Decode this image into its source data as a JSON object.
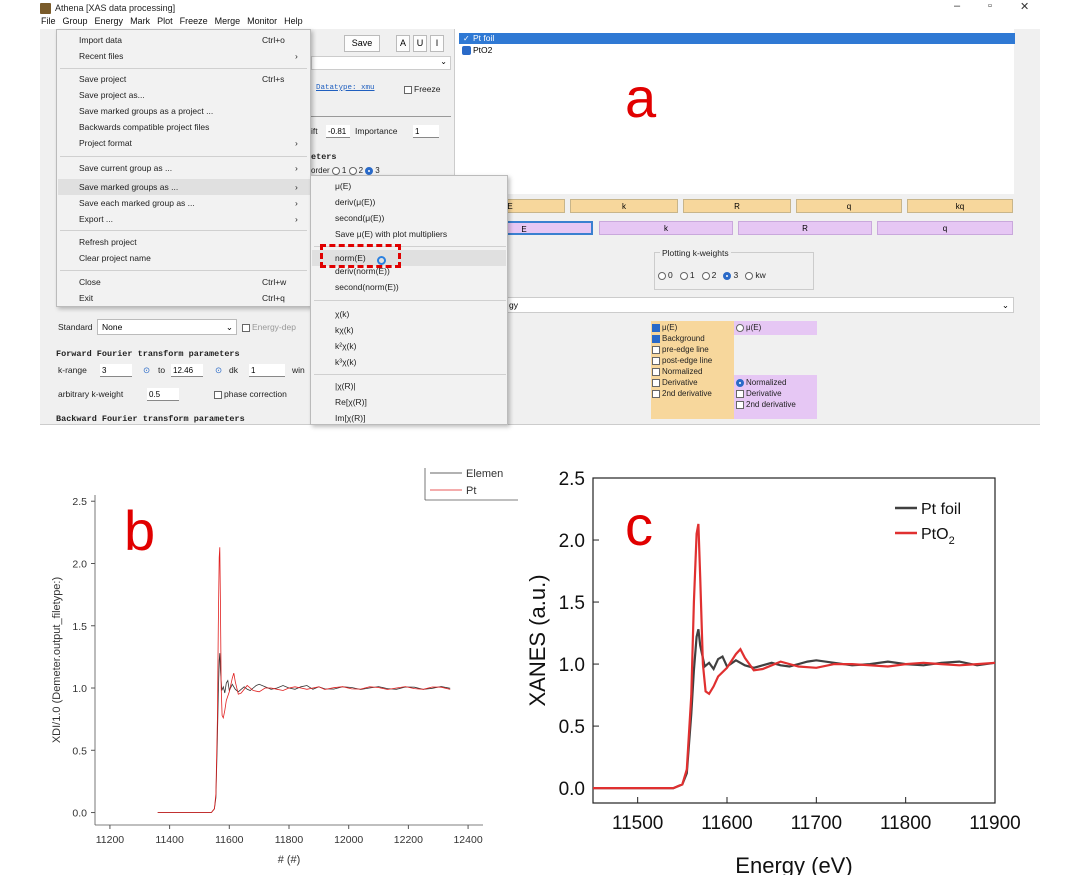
{
  "app": {
    "title": "Athena [XAS data processing]",
    "window_controls": [
      "–",
      "▫",
      "✕"
    ],
    "menus": [
      "File",
      "Group",
      "Energy",
      "Mark",
      "Plot",
      "Freeze",
      "Merge",
      "Monitor",
      "Help"
    ]
  },
  "file_menu": {
    "items": [
      {
        "label": "Import data",
        "shortcut": "Ctrl+o",
        "arrow": ""
      },
      {
        "label": "Recent files",
        "shortcut": "",
        "arrow": "›"
      },
      {
        "label": "Save project",
        "shortcut": "Ctrl+s",
        "arrow": ""
      },
      {
        "label": "Save project as...",
        "shortcut": "",
        "arrow": ""
      },
      {
        "label": "Save marked groups as a project ...",
        "shortcut": "",
        "arrow": ""
      },
      {
        "label": "Backwards compatible project files",
        "shortcut": "",
        "arrow": ""
      },
      {
        "label": "Project format",
        "shortcut": "",
        "arrow": "›"
      },
      {
        "label": "Save current group as ...",
        "shortcut": "",
        "arrow": "›"
      },
      {
        "label": "Save marked groups as ...",
        "shortcut": "",
        "arrow": "›"
      },
      {
        "label": "Save each marked group as ...",
        "shortcut": "",
        "arrow": "›"
      },
      {
        "label": "Export ...",
        "shortcut": "",
        "arrow": "›"
      },
      {
        "label": "Refresh project",
        "shortcut": "",
        "arrow": ""
      },
      {
        "label": "Clear project name",
        "shortcut": "",
        "arrow": ""
      },
      {
        "label": "Close",
        "shortcut": "Ctrl+w",
        "arrow": ""
      },
      {
        "label": "Exit",
        "shortcut": "Ctrl+q",
        "arrow": ""
      }
    ]
  },
  "submenu": {
    "items": [
      "μ(E)",
      "deriv(μ(E))",
      "second(μ(E))",
      "Save μ(E) with plot multipliers",
      "norm(E)",
      "deriv(norm(E))",
      "second(norm(E))",
      "χ(k)",
      "kχ(k)",
      "k²χ(k)",
      "k³χ(k)",
      "|χ(R)|",
      "Re[χ(R)]",
      "Im[χ(R)]"
    ]
  },
  "groups": {
    "items": [
      "Pt foil",
      "PtO2"
    ]
  },
  "toolbar": {
    "save": "Save",
    "a": "A",
    "u": "U",
    "i": "I"
  },
  "main_panel": {
    "datatype": "Datatype: xmu",
    "freeze": "Freeze",
    "shift_label": "ift",
    "shift_value": "-0.81",
    "importance_label": "Importance",
    "importance_value": "1",
    "section_params": "eters",
    "order_label": "order",
    "orders": [
      "1",
      "2",
      "3"
    ],
    "standard_label": "Standard",
    "standard_value": "None",
    "energy_dep": "Energy-dep",
    "fft_header": "Forward Fourier transform parameters",
    "krange_label": "k-range",
    "kmin": "3",
    "to": "to",
    "kmax": "12.46",
    "dk_label": "dk",
    "dk_value": "1",
    "win_label": "win",
    "arb_label": "arbitrary k-weight",
    "arb_value": "0.5",
    "phase_corr": "phase correction",
    "bft_header": "Backward Fourier transform parameters",
    "energy_fragment": "gy"
  },
  "plot_buttons": {
    "row1": [
      "E",
      "k",
      "R",
      "q",
      "kq"
    ],
    "row2": [
      "E",
      "k",
      "R",
      "q"
    ]
  },
  "kweights": {
    "title": "Plotting k-weights",
    "options": [
      "0",
      "1",
      "2",
      "3",
      "kw"
    ],
    "selected": "3"
  },
  "plot_options": {
    "left": [
      "μ(E)",
      "Background",
      "pre-edge line",
      "post-edge line",
      "Normalized",
      "Derivative",
      "2nd derivative"
    ],
    "left_checked": [
      true,
      true,
      false,
      false,
      false,
      false,
      false
    ],
    "right": [
      "μ(E)",
      "Normalized",
      "Derivative",
      "2nd derivative"
    ]
  },
  "labels": {
    "a": "a",
    "b": "b",
    "c": "c"
  },
  "chart_b": {
    "type": "line",
    "ylabel": "XDI/1.0 (Demeter.output_filetype:)",
    "xlabel": "# (#)",
    "legend": [
      "Elemen",
      "Pt"
    ],
    "xticks": [
      11200,
      11400,
      11600,
      11800,
      12000,
      12200,
      12400
    ],
    "yticks": [
      "0.0",
      "0.5",
      "1.0",
      "1.5",
      "2.0",
      "2.5"
    ],
    "xlim": [
      11150,
      12450
    ],
    "ylim": [
      -0.1,
      2.55
    ],
    "series_colors": [
      "#333333",
      "#e02020"
    ]
  },
  "chart_data": {
    "type": "line",
    "xlabel": "Energy (eV)",
    "ylabel": "XANES (a.u.)",
    "xlim": [
      11450,
      11900
    ],
    "ylim": [
      -0.12,
      2.5
    ],
    "xticks": [
      11500,
      11600,
      11700,
      11800,
      11900
    ],
    "yticks": [
      0.0,
      0.5,
      1.0,
      1.5,
      2.0,
      2.5
    ],
    "yticklabels": [
      "0.0",
      "0.5",
      "1.0",
      "1.5",
      "2.0",
      "2.5"
    ],
    "legend": {
      "position": "top-right",
      "entries": [
        "Pt foil",
        "PtO",
        "2"
      ]
    },
    "series": [
      {
        "name": "Pt foil",
        "color": "#404040",
        "x": [
          11450,
          11540,
          11550,
          11555,
          11560,
          11563,
          11566,
          11568,
          11570,
          11575,
          11580,
          11585,
          11590,
          11595,
          11600,
          11610,
          11620,
          11630,
          11640,
          11650,
          11660,
          11670,
          11680,
          11690,
          11700,
          11720,
          11740,
          11760,
          11780,
          11800,
          11820,
          11840,
          11860,
          11880,
          11900
        ],
        "y": [
          0.0,
          0.0,
          0.03,
          0.12,
          0.6,
          0.95,
          1.22,
          1.28,
          1.15,
          0.98,
          1.01,
          0.96,
          1.04,
          1.06,
          0.98,
          1.03,
          0.99,
          0.97,
          0.99,
          1.01,
          0.99,
          0.98,
          1.0,
          1.02,
          1.03,
          1.01,
          0.99,
          1.0,
          1.02,
          1.0,
          0.99,
          1.01,
          1.02,
          0.99,
          1.01
        ]
      },
      {
        "name": "PtO₂",
        "color": "#e03030",
        "x": [
          11450,
          11540,
          11550,
          11555,
          11560,
          11563,
          11566,
          11568,
          11570,
          11573,
          11576,
          11580,
          11585,
          11590,
          11600,
          11610,
          11615,
          11620,
          11630,
          11640,
          11650,
          11660,
          11680,
          11700,
          11720,
          11740,
          11760,
          11780,
          11800,
          11820,
          11840,
          11860,
          11880,
          11900
        ],
        "y": [
          0.0,
          0.0,
          0.03,
          0.15,
          0.75,
          1.5,
          2.05,
          2.13,
          1.7,
          1.0,
          0.78,
          0.76,
          0.82,
          0.9,
          0.97,
          1.08,
          1.12,
          1.05,
          0.95,
          0.96,
          0.99,
          1.02,
          0.98,
          0.97,
          1.0,
          1.0,
          0.99,
          0.98,
          1.0,
          1.01,
          1.0,
          0.99,
          1.0,
          1.01
        ]
      }
    ]
  }
}
